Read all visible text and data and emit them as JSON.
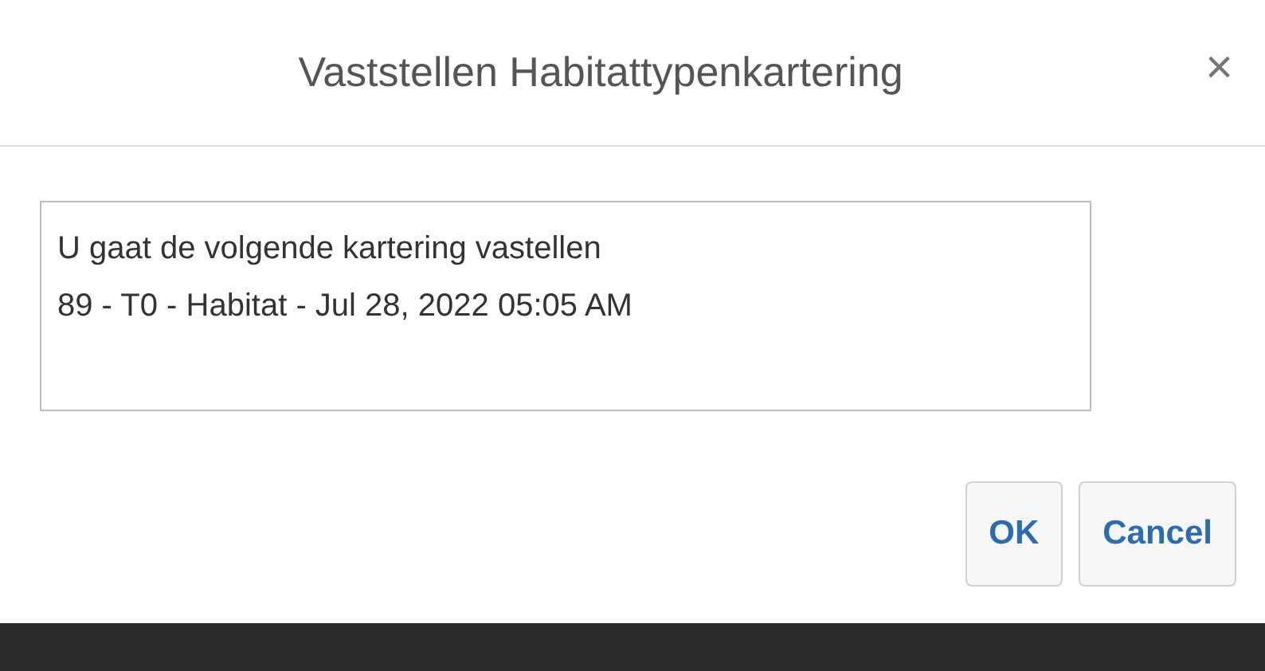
{
  "dialog": {
    "title": "Vaststellen Habitattypenkartering",
    "close": "×"
  },
  "message": [
    "U gaat de volgende kartering vastellen",
    "89 - T0 - Habitat - Jul 28, 2022 05:05 AM"
  ],
  "buttons": [
    "OK",
    "Cancel"
  ]
}
